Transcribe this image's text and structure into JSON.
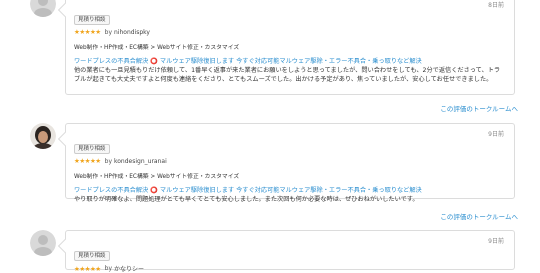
{
  "reviews": [
    {
      "badge": "見積り相談",
      "stars": "★★★★★",
      "user_prefix": "by",
      "username": "nihondispky",
      "date": "8日前",
      "category": "Web制作・HP作成・EC構築 > Webサイト修正・カスタマイズ",
      "title_before": "ワードプレスの不具合解決",
      "title_mark": "⭕",
      "title_after": "マルウェア駆除復旧します 今すぐ対応可能マルウェア駆除・エラー不具合・乗っ取りなど解決",
      "body": "他の業者にも一旦見積もりだけ依頼して、1番早く返事が来た業者にお願いをしようと思ってましたが、問い合わせをしても、2分で返信くださって、トラブルが起きても大丈夫ですよと何度も連絡をくださり、とてもスムーズでした。出かける予定があり、焦っていましたが、安心してお任せできました。",
      "talk_link": "この評価のトークルームへ"
    },
    {
      "badge": "見積り相談",
      "stars": "★★★★★",
      "user_prefix": "by",
      "username": "kondesign_uranai",
      "date": "9日前",
      "category": "Web制作・HP作成・EC構築 > Webサイト修正・カスタマイズ",
      "title_before": "ワードプレスの不具合解決",
      "title_mark": "⭕",
      "title_after": "マルウェア駆除復旧します 今すぐ対応可能マルウェア駆除・エラー不具合・乗っ取りなど解決",
      "body": "やり取りが明確なよ、問題処理がとても早くてとても安心しました。また次回も何か必要な時は、ぜひおねがいしたいです。",
      "talk_link": "この評価のトークルームへ"
    },
    {
      "badge": "見積り相談",
      "stars": "★★★★★",
      "user_prefix": "by",
      "username": "かなりシー",
      "date": "9日前"
    }
  ]
}
